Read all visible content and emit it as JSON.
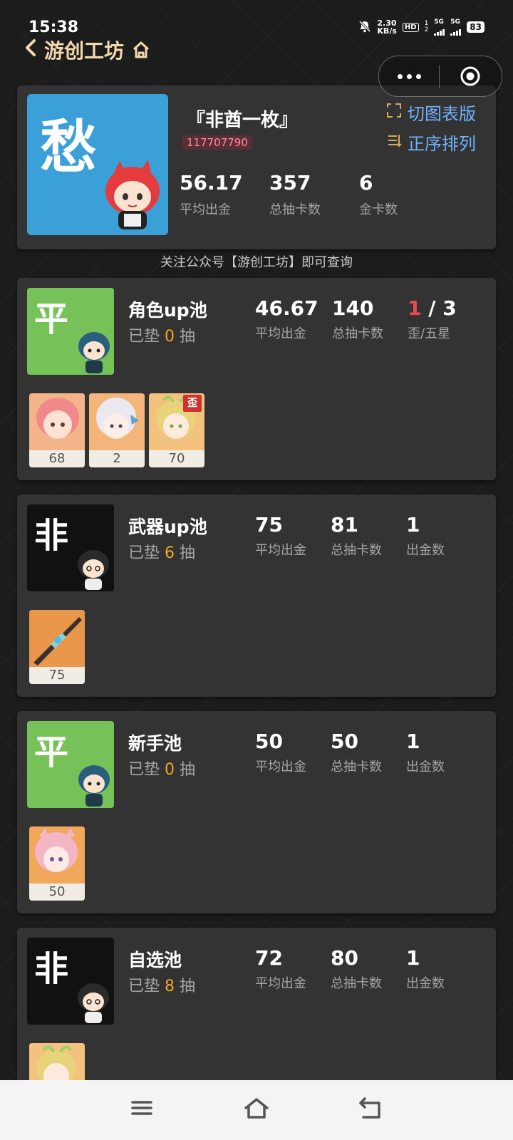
{
  "status_bar": {
    "time": "15:38",
    "net_speed_value": "2.30",
    "net_speed_unit": "KB/s",
    "hd": "HD",
    "sim1": "1",
    "sim2": "2",
    "network1": "5G",
    "network2": "5G",
    "battery": "83"
  },
  "nav": {
    "title": "游创工坊"
  },
  "summary": {
    "grade": "愁",
    "nickname": "『非酋一枚』",
    "uid": "117707790",
    "toggle_view": "切图表版",
    "sort_order": "正序排列",
    "stats": [
      {
        "value": "56.17",
        "label": "平均出金"
      },
      {
        "value": "357",
        "label": "总抽卡数"
      },
      {
        "value": "6",
        "label": "金卡数"
      }
    ]
  },
  "notice": "关注公众号【游创工坊】即可查询",
  "pools": [
    {
      "grade": "平",
      "grade_color": "#77c258",
      "name": "角色up池",
      "pity_prefix": "已垫",
      "pity": "0",
      "pity_suffix": "抽",
      "stats": [
        {
          "value": "46.67",
          "label": "平均出金"
        },
        {
          "value": "140",
          "label": "总抽卡数"
        },
        {
          "value_red": "1",
          "value_rest": " / 3",
          "label": "歪/五星"
        }
      ],
      "pulls": [
        {
          "count": "68",
          "tag": ""
        },
        {
          "count": "2",
          "tag": ""
        },
        {
          "count": "70",
          "tag": "歪"
        }
      ]
    },
    {
      "grade": "非",
      "grade_color": "#111111",
      "name": "武器up池",
      "pity_prefix": "已垫",
      "pity": "6",
      "pity_suffix": "抽",
      "stats": [
        {
          "value": "75",
          "label": "平均出金"
        },
        {
          "value": "81",
          "label": "总抽卡数"
        },
        {
          "value": "1",
          "label": "出金数"
        }
      ],
      "pulls": [
        {
          "count": "75",
          "tag": ""
        }
      ]
    },
    {
      "grade": "平",
      "grade_color": "#77c258",
      "name": "新手池",
      "pity_prefix": "已垫",
      "pity": "0",
      "pity_suffix": "抽",
      "stats": [
        {
          "value": "50",
          "label": "平均出金"
        },
        {
          "value": "50",
          "label": "总抽卡数"
        },
        {
          "value": "1",
          "label": "出金数"
        }
      ],
      "pulls": [
        {
          "count": "50",
          "tag": ""
        }
      ]
    },
    {
      "grade": "非",
      "grade_color": "#111111",
      "name": "自选池",
      "pity_prefix": "已垫",
      "pity": "8",
      "pity_suffix": "抽",
      "stats": [
        {
          "value": "72",
          "label": "平均出金"
        },
        {
          "value": "80",
          "label": "总抽卡数"
        },
        {
          "value": "1",
          "label": "出金数"
        }
      ],
      "pulls": []
    }
  ],
  "icons": {
    "back": "chevron-left-icon",
    "home": "home-icon",
    "more": "more-dots-icon",
    "target": "target-icon",
    "toggle_view": "switch-view-icon",
    "sort": "sort-icon",
    "menu": "menu-icon",
    "system_home": "system-home-icon",
    "system_back": "system-back-icon"
  }
}
